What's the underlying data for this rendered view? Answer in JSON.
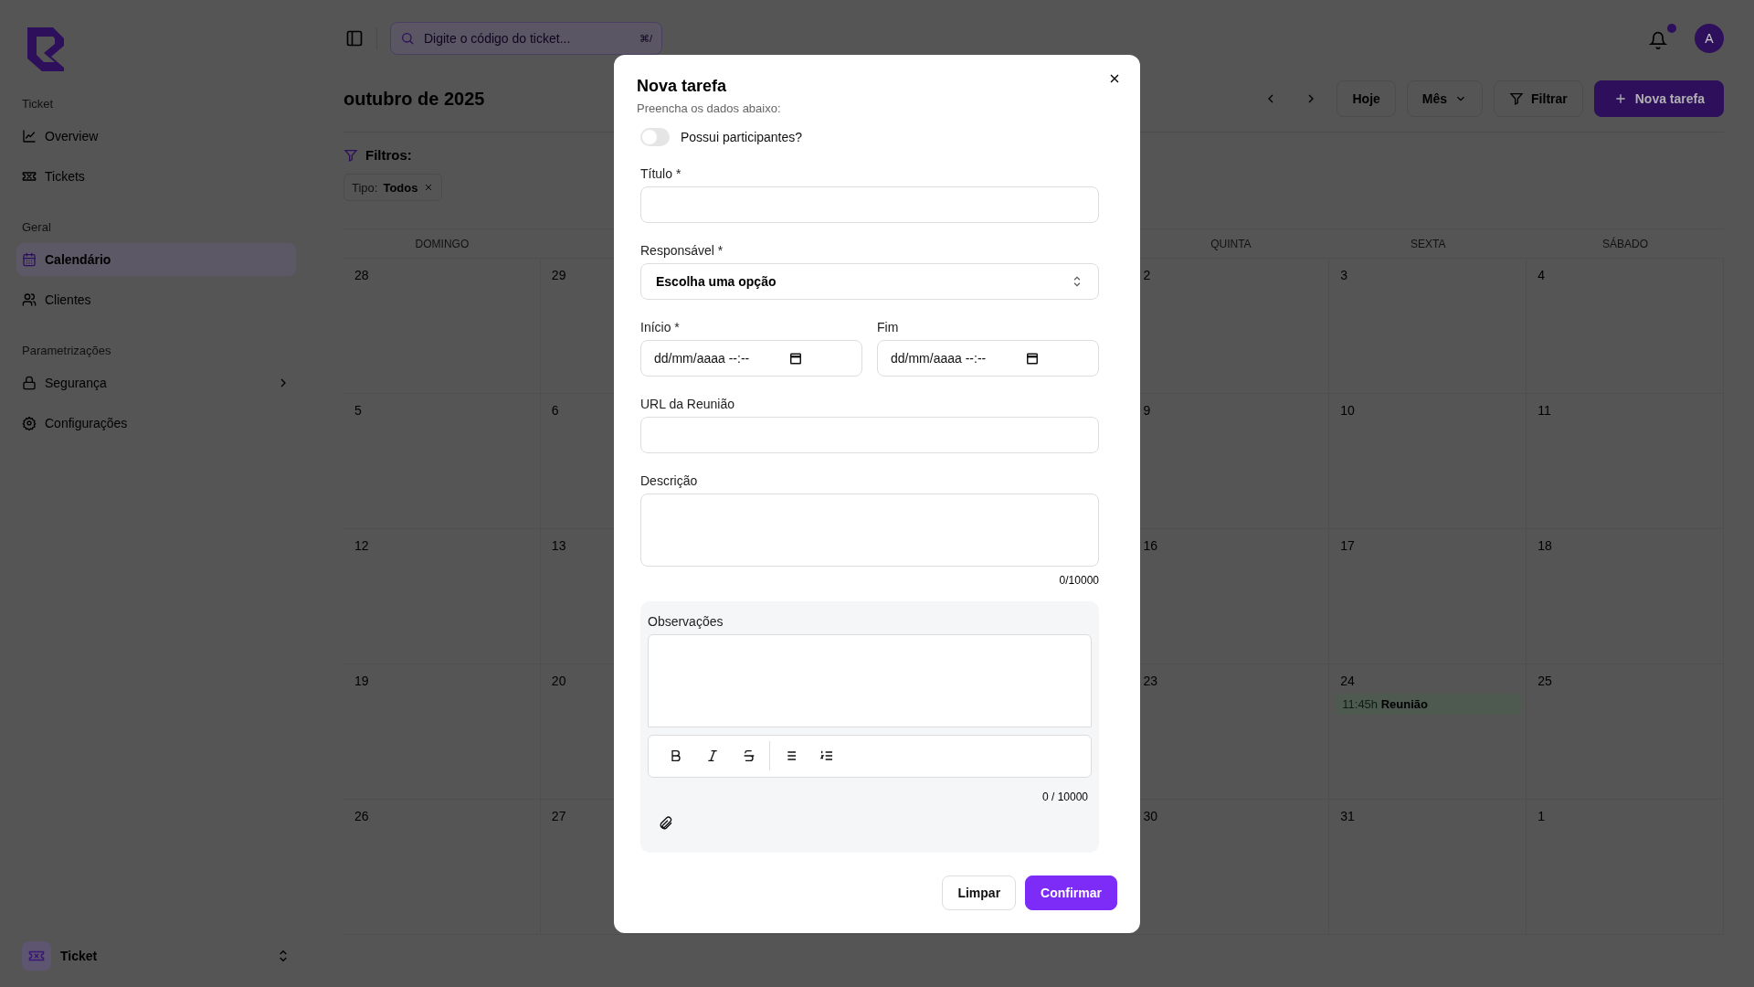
{
  "sidebar": {
    "sections": [
      {
        "title": "Ticket",
        "items": [
          {
            "label": "Overview",
            "selected": false,
            "has_submenu": false
          },
          {
            "label": "Tickets",
            "selected": false,
            "has_submenu": false
          }
        ]
      },
      {
        "title": "Geral",
        "items": [
          {
            "label": "Calendário",
            "selected": true,
            "has_submenu": false
          },
          {
            "label": "Clientes",
            "selected": false,
            "has_submenu": false
          }
        ]
      },
      {
        "title": "Parametrizações",
        "items": [
          {
            "label": "Segurança",
            "selected": false,
            "has_submenu": true
          },
          {
            "label": "Configurações",
            "selected": false,
            "has_submenu": false
          }
        ]
      }
    ],
    "footer": {
      "label": "Ticket"
    }
  },
  "topbar": {
    "search": {
      "placeholder": "Digite o código do ticket...",
      "shortcut": "⌘/"
    },
    "notifications": {
      "unread": true
    },
    "avatar": {
      "initial": "A"
    }
  },
  "header": {
    "title": "outubro de 2025",
    "buttons": [
      {
        "kind": "today",
        "label": "Hoje"
      },
      {
        "kind": "view",
        "label": "Mês"
      },
      {
        "kind": "filter",
        "label": "Filtrar"
      },
      {
        "kind": "primary",
        "label": "Nova tarefa"
      }
    ]
  },
  "filters": {
    "label": "Filtros:",
    "chips": [
      {
        "key": "Tipo:",
        "value": "Todos"
      }
    ]
  },
  "calendar": {
    "weekdays": [
      "DOMINGO",
      "QUINTA",
      "SEXTA",
      "SÁBADO"
    ],
    "weeks": [
      [
        {
          "day": "28"
        },
        {
          "day": "29"
        },
        {
          "day": "2"
        },
        {
          "day": "3"
        },
        {
          "day": "4"
        }
      ],
      [
        {
          "day": "5"
        },
        {
          "day": "6"
        },
        {
          "day": "9"
        },
        {
          "day": "10"
        },
        {
          "day": "11"
        }
      ],
      [
        {
          "day": "12"
        },
        {
          "day": "13"
        },
        {
          "day": "16"
        },
        {
          "day": "17"
        },
        {
          "day": "18"
        }
      ],
      [
        {
          "day": "19"
        },
        {
          "day": "20"
        },
        {
          "day": "23"
        },
        {
          "day": "24",
          "events": [
            {
              "time": "11:45h",
              "title": "Reunião"
            }
          ]
        },
        {
          "day": "25"
        }
      ],
      [
        {
          "day": "26"
        },
        {
          "day": "27"
        },
        {
          "day": "30"
        },
        {
          "day": "31"
        },
        {
          "day": "1"
        }
      ]
    ]
  },
  "modal": {
    "title": "Nova tarefa",
    "subtitle": "Preencha os dados abaixo:",
    "participants_toggle": {
      "label": "Possui participantes?",
      "on": false
    },
    "title_field": {
      "label": "Título *"
    },
    "responsible_field": {
      "label": "Responsável *",
      "value": "Escolha uma opção"
    },
    "start_field": {
      "label": "Início *",
      "placeholder": "dd/mm/aaaa --:--"
    },
    "end_field": {
      "label": "Fim",
      "placeholder": "dd/mm/aaaa --:--"
    },
    "url_field": {
      "label": "URL da Reunião"
    },
    "description_field": {
      "label": "Descrição",
      "counter": "0/10000"
    },
    "observations": {
      "label": "Observações",
      "counter": "0 / 10000"
    },
    "buttons": [
      {
        "kind": "secondary",
        "label": "Limpar"
      },
      {
        "kind": "primary",
        "label": "Confirmar"
      }
    ]
  }
}
